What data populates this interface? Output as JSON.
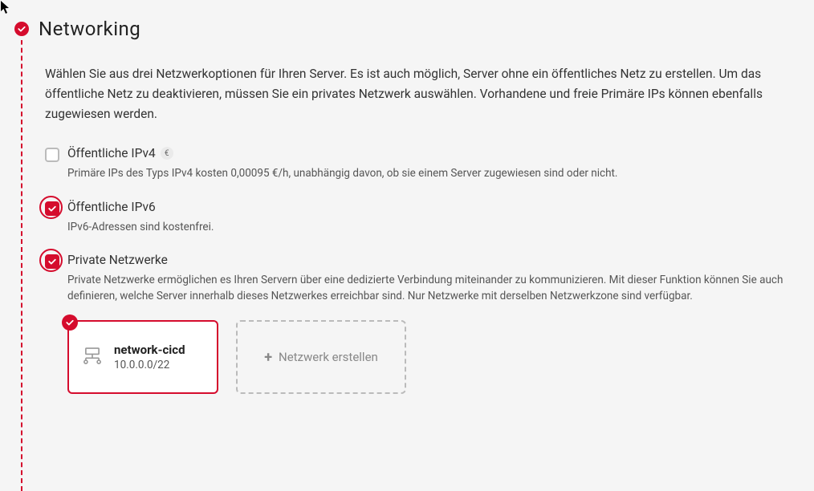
{
  "section": {
    "title": "Networking",
    "intro": "Wählen Sie aus drei Netzwerkoptionen für Ihren Server. Es ist auch möglich, Server ohne ein öffentliches Netz zu erstellen. Um das öffentliche Netz zu deaktivieren, müssen Sie ein privates Netzwerk auswählen. Vorhandene und freie Primäre IPs können ebenfalls zugewiesen werden."
  },
  "options": {
    "ipv4": {
      "label": "Öffentliche IPv4",
      "price_symbol": "€",
      "desc": "Primäre IPs des Typs IPv4 kosten 0,00095 €/h, unabhängig davon, ob sie einem Server zugewiesen sind oder nicht.",
      "checked": false
    },
    "ipv6": {
      "label": "Öffentliche IPv6",
      "desc": "IPv6-Adressen sind kostenfrei.",
      "checked": true
    },
    "private": {
      "label": "Private Netzwerke",
      "desc": "Private Netzwerke ermöglichen es Ihren Servern über eine dedizierte Verbindung miteinander zu kommunizieren. Mit dieser Funktion können Sie auch definieren, welche Server innerhalb dieses Netzwerkes erreichbar sind. Nur Netzwerke mit derselben Netzwerkzone sind verfügbar.",
      "checked": true
    }
  },
  "networks": {
    "selected": {
      "name": "network-cicd",
      "cidr": "10.0.0.0/22"
    },
    "create_label": "Netzwerk erstellen"
  }
}
